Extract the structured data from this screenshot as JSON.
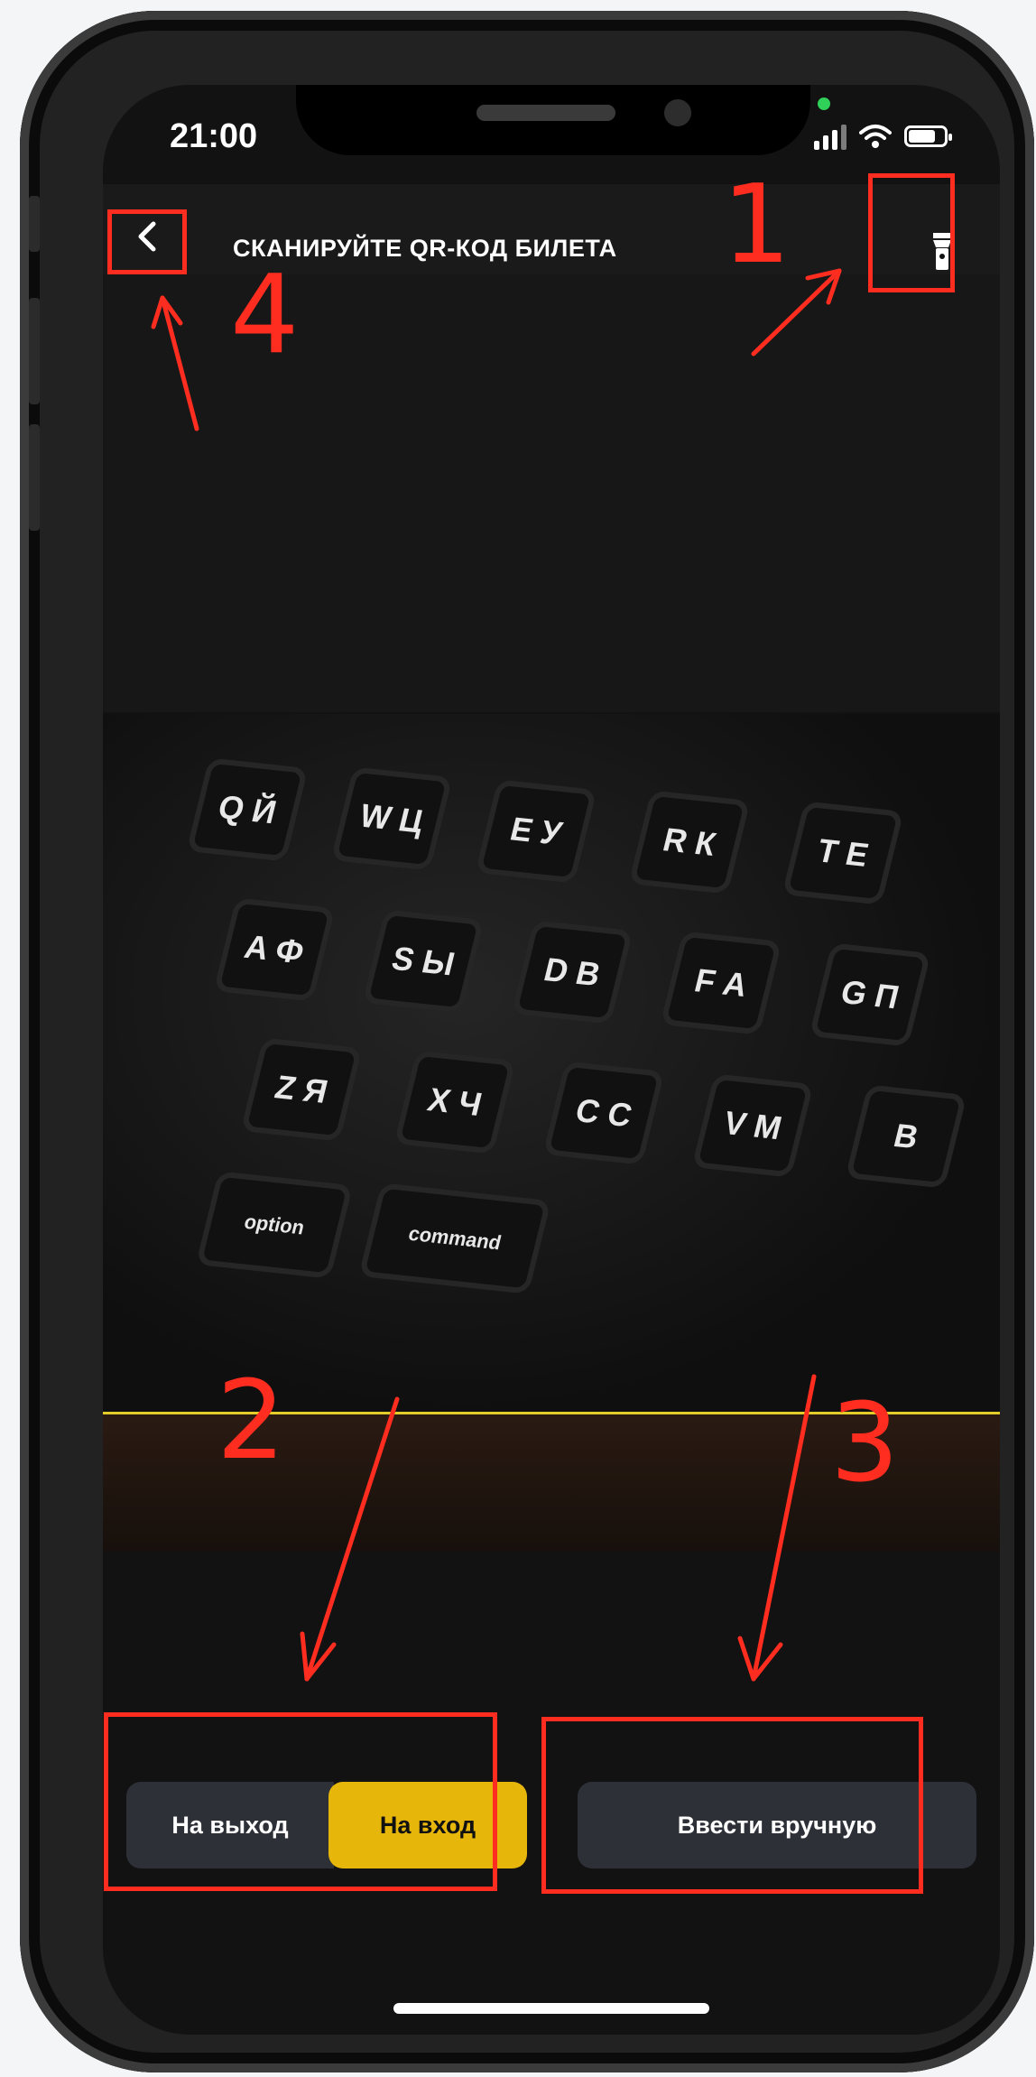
{
  "status_bar": {
    "time": "21:00",
    "icons": [
      "signal-icon",
      "wifi-icon",
      "battery-icon"
    ]
  },
  "header": {
    "back_icon": "chevron-left-icon",
    "title": "СКАНИРУЙТЕ QR-КОД БИЛЕТА",
    "flashlight_icon": "flashlight-icon"
  },
  "camera": {
    "keys": [
      "Q Й",
      "W Ц",
      "E У",
      "R К",
      "T Е",
      "A Ф",
      "S Ы",
      "D В",
      "F А",
      "G П",
      "Z Я",
      "X Ч",
      "C С",
      "V М",
      "B",
      "option",
      "command"
    ]
  },
  "controls": {
    "exit_label": "На выход",
    "entry_label": "На вход",
    "manual_label": "Ввести вручную",
    "selected": "На вход"
  },
  "annotations": [
    "1",
    "2",
    "3",
    "4"
  ],
  "colors": {
    "accent": "#e6b60a",
    "button_dark": "#2e3038",
    "annotation": "#ff2d20"
  }
}
